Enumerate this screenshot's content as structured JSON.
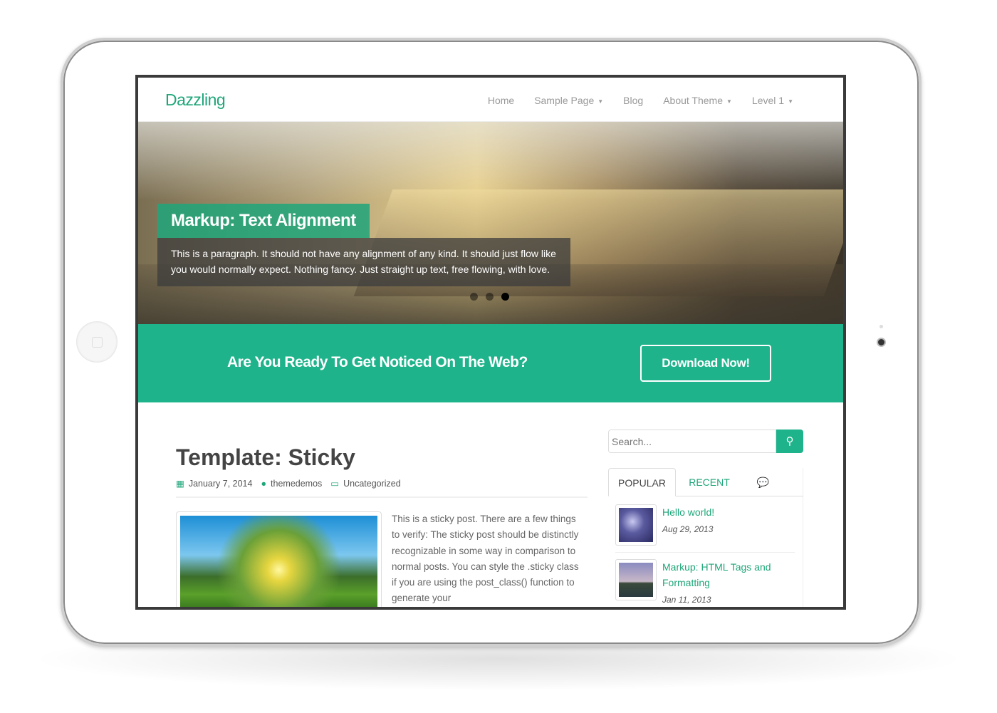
{
  "site": {
    "logo": "Dazzling"
  },
  "nav": [
    {
      "label": "Home",
      "dropdown": false
    },
    {
      "label": "Sample Page",
      "dropdown": true
    },
    {
      "label": "Blog",
      "dropdown": false
    },
    {
      "label": "About Theme",
      "dropdown": true
    },
    {
      "label": "Level 1",
      "dropdown": true
    }
  ],
  "slider": {
    "title": "Markup: Text Alignment",
    "text": "This is a paragraph. It should not have any alignment of any kind. It should just flow like you would normally expect. Nothing fancy. Just straight up text, free flowing, with love.",
    "slide_count": 3,
    "active_slide": 3
  },
  "cta": {
    "text": "Are You Ready To Get Noticed On The Web?",
    "button": "Download Now!"
  },
  "post": {
    "title": "Template: Sticky",
    "date": "January 7, 2014",
    "author": "themedemos",
    "category": "Uncategorized",
    "excerpt": "This is a sticky post. There are a few things to verify: The sticky post should be distinctly recognizable in some way in comparison to normal posts. You can style the .sticky class if you are using the post_class() function to generate your"
  },
  "sidebar": {
    "search_placeholder": "Search...",
    "tabs": {
      "popular": "POPULAR",
      "recent": "RECENT",
      "comments_icon": "comments-icon"
    },
    "items": [
      {
        "title": "Hello world!",
        "date": "Aug 29, 2013"
      },
      {
        "title": "Markup: HTML Tags and Formatting",
        "date": "Jan 11, 2013"
      }
    ]
  },
  "colors": {
    "accent": "#1fb38b",
    "link": "#1fa67a"
  }
}
